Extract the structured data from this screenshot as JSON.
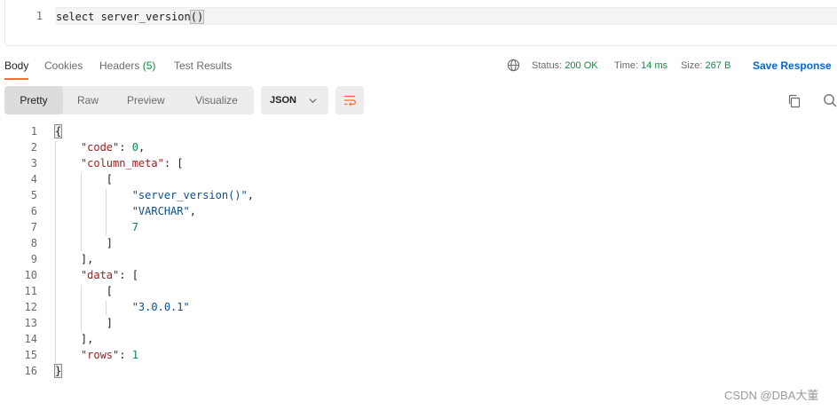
{
  "request": {
    "line_number": "1",
    "query_prefix": "select server_version",
    "query_parens": "()"
  },
  "response_tabs": [
    {
      "label": "Body"
    },
    {
      "label": "Cookies"
    },
    {
      "label": "Headers",
      "count": "(5)"
    },
    {
      "label": "Test Results"
    }
  ],
  "status": {
    "status_label": "Status:",
    "status_value": "200 OK",
    "time_label": "Time:",
    "time_value": "14 ms",
    "size_label": "Size:",
    "size_value": "267 B",
    "save_response": "Save Response"
  },
  "view_modes": [
    "Pretty",
    "Raw",
    "Preview",
    "Visualize"
  ],
  "format_select": "JSON",
  "code_lines": [
    {
      "n": "1",
      "parts": [
        {
          "t": "{",
          "c": "brace"
        }
      ]
    },
    {
      "n": "2",
      "parts": [
        {
          "t": "    "
        },
        {
          "t": "\"code\"",
          "c": "k"
        },
        {
          "t": ": "
        },
        {
          "t": "0",
          "c": "n"
        },
        {
          "t": ","
        }
      ]
    },
    {
      "n": "3",
      "parts": [
        {
          "t": "    "
        },
        {
          "t": "\"column_meta\"",
          "c": "k"
        },
        {
          "t": ": ["
        }
      ]
    },
    {
      "n": "4",
      "parts": [
        {
          "t": "        ["
        }
      ]
    },
    {
      "n": "5",
      "parts": [
        {
          "t": "            "
        },
        {
          "t": "\"server_version()\"",
          "c": "s"
        },
        {
          "t": ","
        }
      ]
    },
    {
      "n": "6",
      "parts": [
        {
          "t": "            "
        },
        {
          "t": "\"VARCHAR\"",
          "c": "s"
        },
        {
          "t": ","
        }
      ]
    },
    {
      "n": "7",
      "parts": [
        {
          "t": "            "
        },
        {
          "t": "7",
          "c": "n"
        }
      ]
    },
    {
      "n": "8",
      "parts": [
        {
          "t": "        ]"
        }
      ]
    },
    {
      "n": "9",
      "parts": [
        {
          "t": "    ],"
        }
      ]
    },
    {
      "n": "10",
      "parts": [
        {
          "t": "    "
        },
        {
          "t": "\"data\"",
          "c": "k"
        },
        {
          "t": ": ["
        }
      ]
    },
    {
      "n": "11",
      "parts": [
        {
          "t": "        ["
        }
      ]
    },
    {
      "n": "12",
      "parts": [
        {
          "t": "            "
        },
        {
          "t": "\"3.0.0.1\"",
          "c": "s"
        }
      ]
    },
    {
      "n": "13",
      "parts": [
        {
          "t": "        ]"
        }
      ]
    },
    {
      "n": "14",
      "parts": [
        {
          "t": "    ],"
        }
      ]
    },
    {
      "n": "15",
      "parts": [
        {
          "t": "    "
        },
        {
          "t": "\"rows\"",
          "c": "k"
        },
        {
          "t": ": "
        },
        {
          "t": "1",
          "c": "n"
        }
      ]
    },
    {
      "n": "16",
      "parts": [
        {
          "t": "}",
          "c": "brace"
        }
      ]
    }
  ],
  "watermark": "CSDN @DBA大董",
  "colors": {
    "accent": "#ff6c37",
    "status_ok": "#0b8f3f",
    "link": "#0265d2",
    "json_key": "#9b1b1b",
    "json_string": "#0d4f8b",
    "json_number": "#098658"
  },
  "icons": [
    "globe-icon",
    "chevron-down-icon",
    "wrap-lines-icon",
    "copy-icon",
    "search-icon"
  ]
}
